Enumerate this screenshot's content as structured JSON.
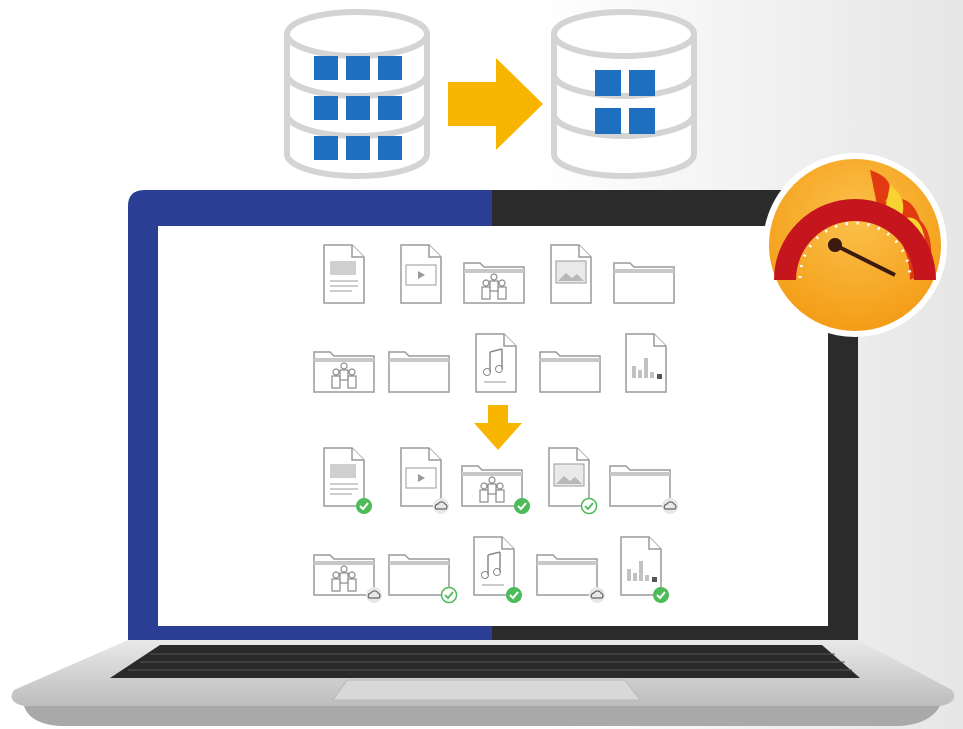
{
  "colors": {
    "arrow": "#f7b500",
    "tile": "#1f6fc1",
    "bezel_left": "#2a3f94",
    "bezel_right": "#2b2b2b",
    "check": "#4cbb58",
    "gauge_flame": "#e23a10",
    "gauge_bg": "#f6a31b"
  },
  "icons": {
    "source_database": "database-icon",
    "target_database": "database-icon",
    "migrate_arrow": "arrow-right-icon",
    "dedupe_arrow": "arrow-down-icon",
    "speed_gauge": "speedometer-icon"
  },
  "files_before": [
    [
      "document",
      "video",
      "shared-folder",
      "image",
      "folder"
    ],
    [
      "shared-folder",
      "folder",
      "audio",
      "folder",
      "chart-document"
    ]
  ],
  "files_after": [
    [
      {
        "type": "document",
        "status": "synced"
      },
      {
        "type": "video",
        "status": "cloud"
      },
      {
        "type": "shared-folder",
        "status": "synced"
      },
      {
        "type": "image",
        "status": "synced-outline"
      },
      {
        "type": "folder",
        "status": "cloud"
      }
    ],
    [
      {
        "type": "shared-folder",
        "status": "cloud"
      },
      {
        "type": "folder",
        "status": "synced-outline"
      },
      {
        "type": "audio",
        "status": "synced"
      },
      {
        "type": "folder",
        "status": "cloud"
      },
      {
        "type": "chart-document",
        "status": "synced"
      }
    ]
  ]
}
